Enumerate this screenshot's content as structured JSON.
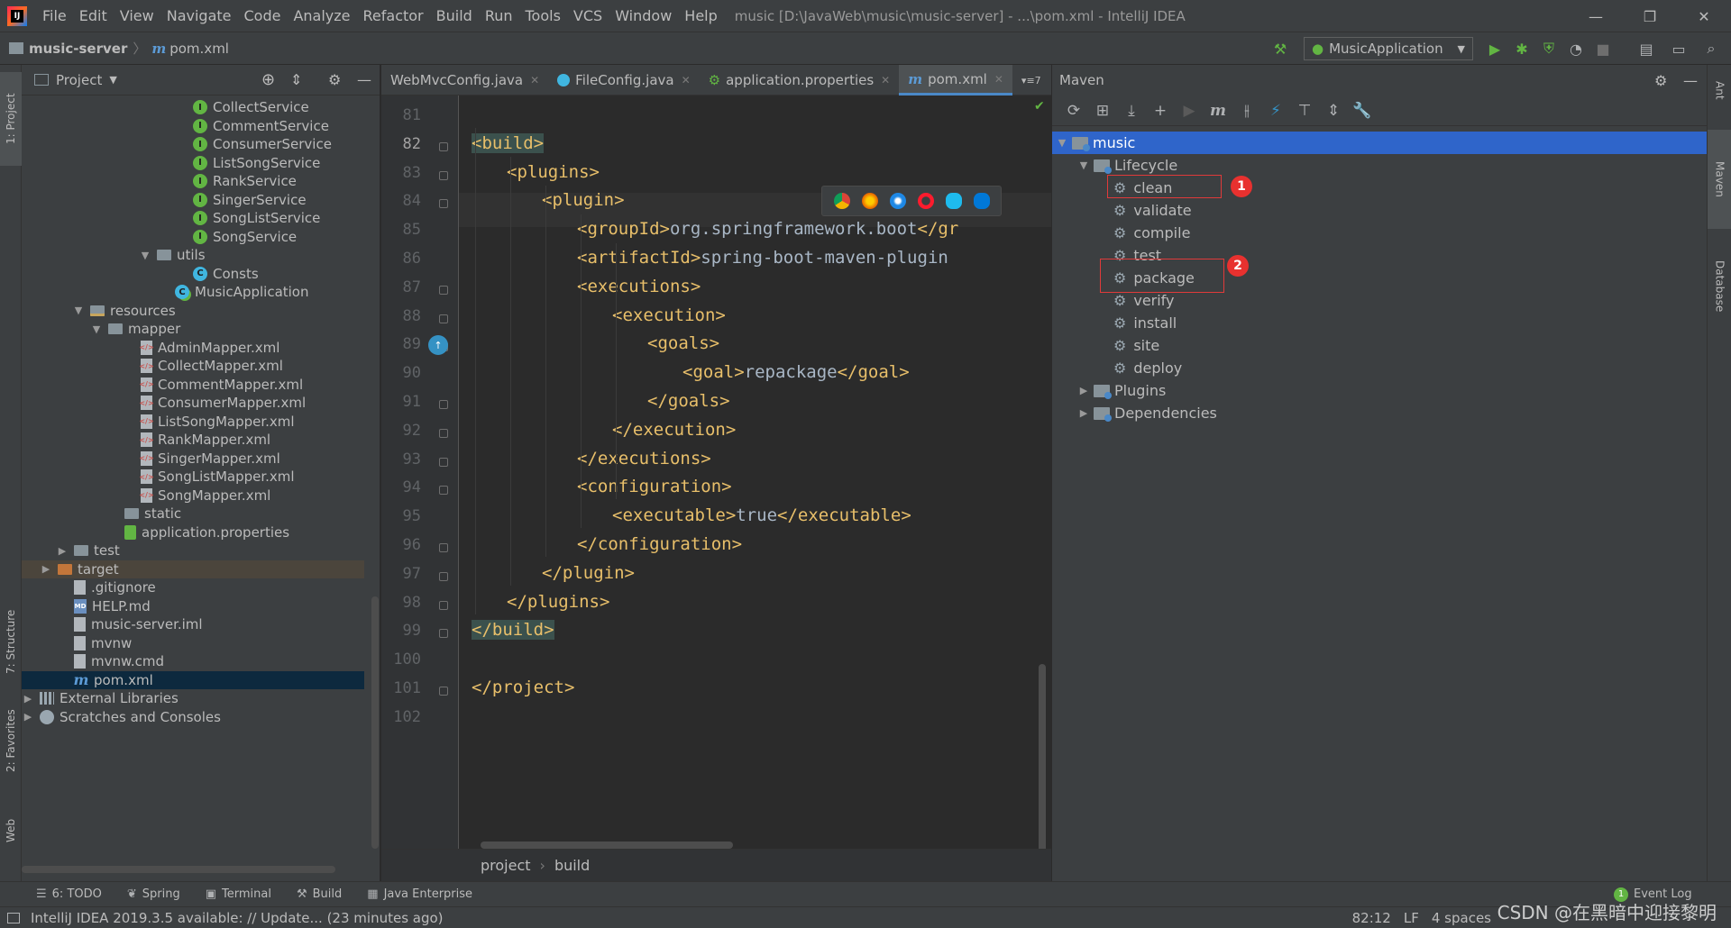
{
  "window": {
    "title": "music [D:\\JavaWeb\\music\\music-server] - ...\\pom.xml - IntelliJ IDEA",
    "menu": [
      "File",
      "Edit",
      "View",
      "Navigate",
      "Code",
      "Analyze",
      "Refactor",
      "Build",
      "Run",
      "Tools",
      "VCS",
      "Window",
      "Help"
    ]
  },
  "nav": {
    "project": "music-server",
    "file": "pom.xml",
    "run_config": "MusicApplication"
  },
  "left_stripe": {
    "project_tab": "1: Project",
    "structure_tab": "7: Structure",
    "favorites_tab": "2: Favorites",
    "web_tab": "Web"
  },
  "project_panel": {
    "title": "Project",
    "rows": [
      {
        "label": "CollectService",
        "icon": "interface"
      },
      {
        "label": "CommentService",
        "icon": "interface"
      },
      {
        "label": "ConsumerService",
        "icon": "interface"
      },
      {
        "label": "ListSongService",
        "icon": "interface"
      },
      {
        "label": "RankService",
        "icon": "interface"
      },
      {
        "label": "SingerService",
        "icon": "interface"
      },
      {
        "label": "SongListService",
        "icon": "interface"
      },
      {
        "label": "SongService",
        "icon": "interface"
      },
      {
        "label": "utils",
        "icon": "folder"
      },
      {
        "label": "Consts",
        "icon": "class"
      },
      {
        "label": "MusicApplication",
        "icon": "app"
      },
      {
        "label": "resources",
        "icon": "folder-res"
      },
      {
        "label": "mapper",
        "icon": "folder"
      },
      {
        "label": "AdminMapper.xml",
        "icon": "xml"
      },
      {
        "label": "CollectMapper.xml",
        "icon": "xml"
      },
      {
        "label": "CommentMapper.xml",
        "icon": "xml"
      },
      {
        "label": "ConsumerMapper.xml",
        "icon": "xml"
      },
      {
        "label": "ListSongMapper.xml",
        "icon": "xml"
      },
      {
        "label": "RankMapper.xml",
        "icon": "xml"
      },
      {
        "label": "SingerMapper.xml",
        "icon": "xml"
      },
      {
        "label": "SongListMapper.xml",
        "icon": "xml"
      },
      {
        "label": "SongMapper.xml",
        "icon": "xml"
      },
      {
        "label": "static",
        "icon": "folder"
      },
      {
        "label": "application.properties",
        "icon": "props"
      },
      {
        "label": "test",
        "icon": "folder"
      },
      {
        "label": "target",
        "icon": "folder-target"
      },
      {
        "label": ".gitignore",
        "icon": "file"
      },
      {
        "label": "HELP.md",
        "icon": "md"
      },
      {
        "label": "music-server.iml",
        "icon": "file"
      },
      {
        "label": "mvnw",
        "icon": "file"
      },
      {
        "label": "mvnw.cmd",
        "icon": "file"
      },
      {
        "label": "pom.xml",
        "icon": "maven"
      },
      {
        "label": "External Libraries",
        "icon": "libs"
      },
      {
        "label": "Scratches and Consoles",
        "icon": "scratch"
      }
    ]
  },
  "editor": {
    "tabs": [
      {
        "label": "WebMvcConfig.java",
        "active": false
      },
      {
        "label": "FileConfig.java",
        "active": false
      },
      {
        "label": "application.properties",
        "active": false
      },
      {
        "label": "pom.xml",
        "active": true
      }
    ],
    "tab_overflow": "7",
    "lines": [
      {
        "n": "81",
        "code": ""
      },
      {
        "n": "82",
        "code": "<build>"
      },
      {
        "n": "83",
        "code": "    <plugins>"
      },
      {
        "n": "84",
        "code": "        <plugin>"
      },
      {
        "n": "85",
        "code": "            <groupId>org.springframework.boot</gr"
      },
      {
        "n": "86",
        "code": "            <artifactId>spring-boot-maven-plugin<"
      },
      {
        "n": "87",
        "code": "            <executions>"
      },
      {
        "n": "88",
        "code": "                <execution>"
      },
      {
        "n": "89",
        "code": "                    <goals>"
      },
      {
        "n": "90",
        "code": "                        <goal>repackage</goal>"
      },
      {
        "n": "91",
        "code": "                    </goals>"
      },
      {
        "n": "92",
        "code": "                </execution>"
      },
      {
        "n": "93",
        "code": "            </executions>"
      },
      {
        "n": "94",
        "code": "            <configuration>"
      },
      {
        "n": "95",
        "code": "                <executable>true</executable>"
      },
      {
        "n": "96",
        "code": "            </configuration>"
      },
      {
        "n": "97",
        "code": "        </plugin>"
      },
      {
        "n": "98",
        "code": "    </plugins>"
      },
      {
        "n": "99",
        "code": "</build>"
      },
      {
        "n": "100",
        "code": ""
      },
      {
        "n": "101",
        "code": "</project>"
      },
      {
        "n": "102",
        "code": ""
      }
    ],
    "breadcrumb": [
      "project",
      "build"
    ]
  },
  "maven": {
    "title": "Maven",
    "root": "music",
    "lifecycle_label": "Lifecycle",
    "lifecycle": [
      "clean",
      "validate",
      "compile",
      "test",
      "package",
      "verify",
      "install",
      "site",
      "deploy"
    ],
    "plugins_label": "Plugins",
    "dependencies_label": "Dependencies",
    "annotations": [
      "1",
      "2"
    ]
  },
  "right_stripe": {
    "ant": "Ant",
    "maven": "Maven",
    "database": "Database"
  },
  "bottom_tools": [
    {
      "label": "6: TODO",
      "icon": "list-icon"
    },
    {
      "label": "Spring",
      "icon": "spring-icon"
    },
    {
      "label": "Terminal",
      "icon": "terminal-icon"
    },
    {
      "label": "Build",
      "icon": "hammer-icon"
    },
    {
      "label": "Java Enterprise",
      "icon": "enterprise-icon"
    }
  ],
  "event_log": {
    "count": "1",
    "label": "Event Log"
  },
  "status": {
    "message": "IntelliJ IDEA 2019.3.5 available: // Update... (23 minutes ago)",
    "position": "82:12",
    "line_sep": "LF",
    "indent": "4 spaces"
  },
  "watermark": "CSDN @在黑暗中迎接黎明",
  "colors": {
    "accent": "#4a88c7",
    "tag": "#e8bf6a",
    "annotation_red": "#e03a3a",
    "selection": "#0d293e"
  }
}
